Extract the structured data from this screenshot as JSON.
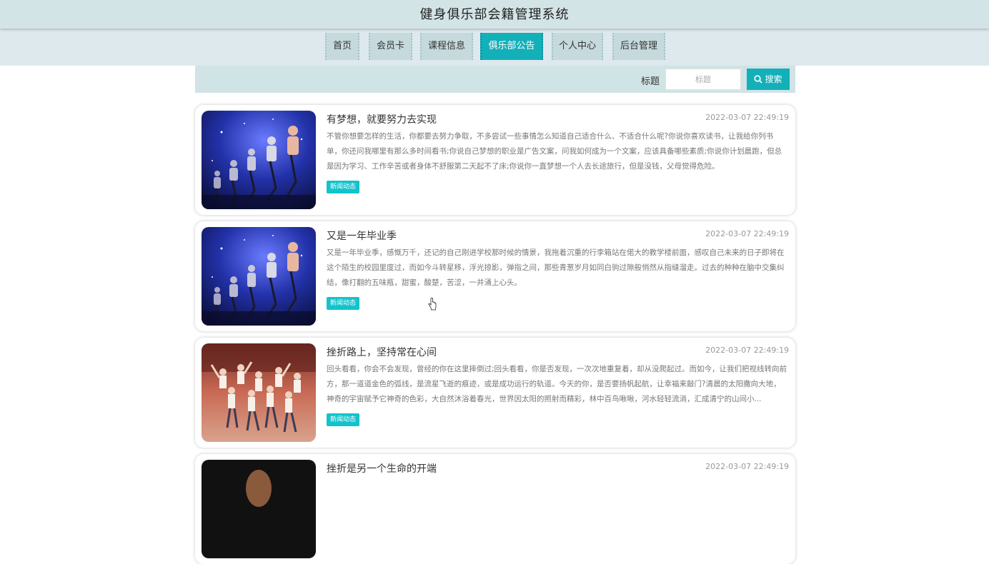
{
  "site": {
    "title": "健身俱乐部会籍管理系统"
  },
  "nav": {
    "items": [
      {
        "label": "首页"
      },
      {
        "label": "会员卡"
      },
      {
        "label": "课程信息"
      },
      {
        "label": "俱乐部公告",
        "active": true
      },
      {
        "label": "个人中心"
      },
      {
        "label": "后台管理"
      }
    ]
  },
  "search": {
    "label": "标题",
    "placeholder": "标题",
    "button": "搜索",
    "icon": "search-icon"
  },
  "notices": [
    {
      "title": "有梦想，就要努力去实现",
      "date": "2022-03-07 22:49:19",
      "body": "不管你想要怎样的生活，你都要去努力争取，不多尝试一些事情怎么知道自己适合什么、不适合什么呢?你说你喜欢读书，让我给你列书单，你还问我哪里有那么多时间看书;你说自己梦想的职业是广告文案，问我如何成为一个文案，应该具备哪些素质;你说你计划晨跑，但总是因为学习、工作辛苦或者身体不舒服第二天起不了床;你说你一直梦想一个人去长途旅行，但是没钱，父母觉得危险。",
      "tag": "新闻动态",
      "image": "spin-class"
    },
    {
      "title": "又是一年毕业季",
      "date": "2022-03-07 22:49:19",
      "body": "又是一年毕业季，感慨万千，还记的自己刚进学校那时候的情景，我拖着沉重的行李箱站在偌大的教学楼前面，感叹自己未来的日子即将在这个陌生的校园里度过，而如今斗转星移，浮光掠影，弹指之间，那些青葱岁月如同白驹过隙般悄然从指缝溜走。过去的种种在脑中交集纠结，像打翻的五味瓶，甜蜜，酸楚，苦涩，一并涌上心头。",
      "tag": "新闻动态",
      "image": "spin-class"
    },
    {
      "title": "挫折路上，坚持常在心间",
      "date": "2022-03-07 22:49:19",
      "body": "回头看看，你会不会发现，曾经的你在这里摔倒过;回头看看，你是否发现，一次次地重复着，却从没爬起过。而如今，让我们把视线转向前方，那一道道金色的弧线，是流星飞逝的痕迹，或是成功运行的轨道。今天的你，是否要扬帆起航，让幸福来敲门?清晨的太阳撒向大地，神奇的宇宙赋予它神奇的色彩，大自然沐浴着春光，世界因太阳的照射而精彩，林中百鸟啾啾，河水轻轻流淌，汇成清宁的山间小...",
      "tag": "新闻动态",
      "image": "dance-class"
    },
    {
      "title": "挫折是另一个生命的开端",
      "date": "2022-03-07 22:49:19",
      "body": "",
      "tag": "",
      "image": "dark-portrait"
    }
  ],
  "colors": {
    "accent": "#13b0b9",
    "header_bg": "#d3e4e6",
    "nav_bg": "#dde9ed"
  }
}
